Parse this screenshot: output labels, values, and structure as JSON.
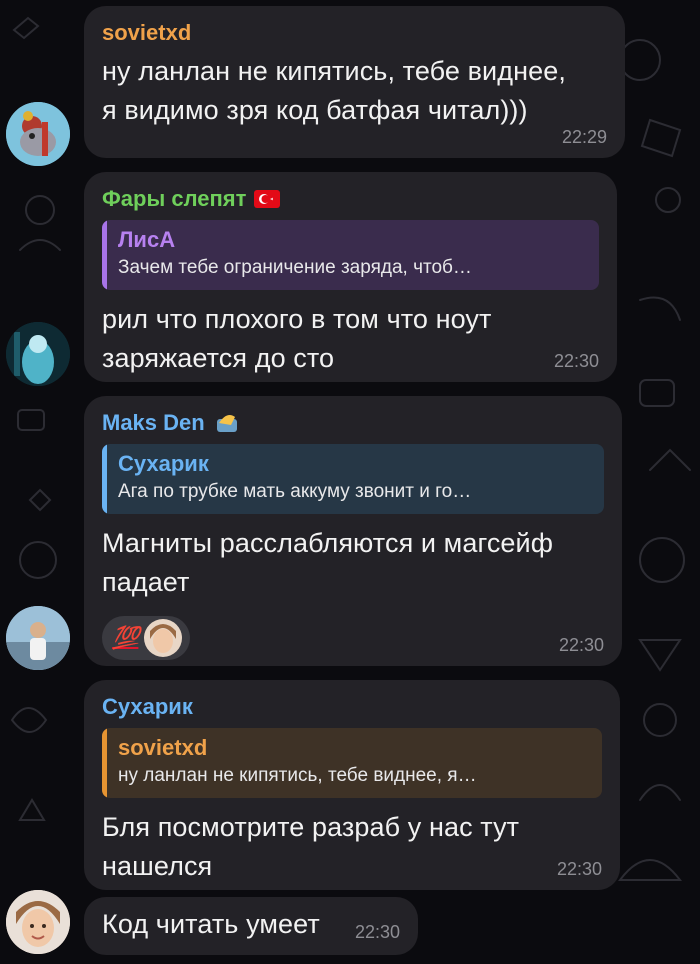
{
  "colors": {
    "background": "#0b0b0f",
    "bubble": "#232227",
    "time": "#8e8e94",
    "sovietxd": "#f0a24a",
    "fary": "#6fcf5b",
    "lisa": "#a874e8",
    "maks": "#6ab3f3",
    "suharik": "#6ab3f3"
  },
  "messages": [
    {
      "sender": "sovietxd",
      "text_lines": [
        "ну ланлан не кипятись, тебе виднее,",
        "я видимо зря код батфая читал)))"
      ],
      "time": "22:29"
    },
    {
      "sender": "Фары слепят",
      "sender_badge": "turkey-flag-icon",
      "reply": {
        "name": "ЛисА",
        "text": "Зачем тебе ограничение заряда, чтоб…"
      },
      "text_lines": [
        "рил что плохого в том что ноут",
        "заряжается до сто"
      ],
      "time": "22:30"
    },
    {
      "sender": "Maks Den",
      "sender_badge": "hand-emoji-icon",
      "reply": {
        "name": "Сухарик",
        "text": "Ага по трубке мать аккуму звонит и го…"
      },
      "text_lines": [
        "Магниты расслабляются и магсейф",
        "падает"
      ],
      "reactions": [
        "hundred-points-emoji",
        "reactor-avatar"
      ],
      "reaction_text": "💯",
      "time": "22:30"
    },
    {
      "sender": "Сухарик",
      "reply": {
        "name": "sovietxd",
        "text": "ну ланлан не кипятись, тебе виднее, я…"
      },
      "text_lines": [
        "Бля посмотрите разраб у нас тут",
        "нашелся"
      ],
      "time": "22:30"
    },
    {
      "text_lines": [
        "Код читать умеет"
      ],
      "time": "22:30"
    }
  ]
}
